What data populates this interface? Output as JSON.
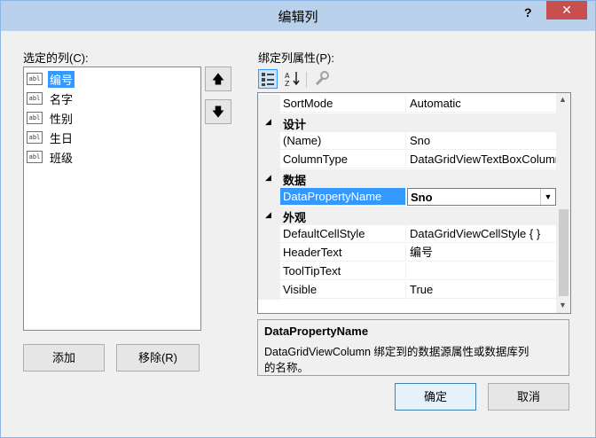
{
  "window": {
    "title": "编辑列",
    "help": "?",
    "close": "✕"
  },
  "left": {
    "label": "选定的列(C):",
    "items": [
      {
        "label": "编号",
        "selected": true
      },
      {
        "label": "名字"
      },
      {
        "label": "性别"
      },
      {
        "label": "生日"
      },
      {
        "label": "班级"
      }
    ],
    "item_icon": "abl-icon",
    "add_button": "添加",
    "remove_button": "移除(R)"
  },
  "move": {
    "up_icon": "arrow-up-icon",
    "down_icon": "arrow-down-icon",
    "up_glyph": "🡅",
    "down_glyph": "🡇"
  },
  "properties": {
    "label": "绑定列属性(P):",
    "rows": {
      "sortmode": {
        "name": "SortMode",
        "value": "Automatic"
      },
      "cat_design": "设计",
      "name": {
        "name": "(Name)",
        "value": "Sno"
      },
      "columntype": {
        "name": "ColumnType",
        "value": "DataGridViewTextBoxColumn"
      },
      "cat_data": "数据",
      "datapropertyname": {
        "name": "DataPropertyName",
        "value": "Sno"
      },
      "cat_appearance": "外观",
      "defaultcellstyle": {
        "name": "DefaultCellStyle",
        "value": "DataGridViewCellStyle { }"
      },
      "headertext": {
        "name": "HeaderText",
        "value": "编号"
      },
      "tooltiptext": {
        "name": "ToolTipText",
        "value": ""
      },
      "visible": {
        "name": "Visible",
        "value": "True"
      }
    },
    "description": {
      "title": "DataPropertyName",
      "line1": "DataGridViewColumn 绑定到的数据源属性或数据库列",
      "line2": "的名称。"
    }
  },
  "footer": {
    "ok": "确定",
    "cancel": "取消"
  },
  "colors": {
    "title_bg": "#b9d1ea",
    "selection": "#3399ff",
    "close_bg": "#c7504e"
  }
}
